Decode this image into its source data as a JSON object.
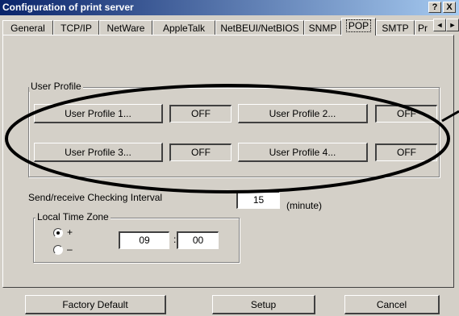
{
  "window": {
    "title": "Configuration of print server",
    "help_label": "?",
    "close_label": "X"
  },
  "tabs": [
    "General",
    "TCP/IP",
    "NetWare",
    "AppleTalk",
    "NetBEUI/NetBIOS",
    "SNMP",
    "POP",
    "SMTP",
    "Pr"
  ],
  "active_tab": "POP",
  "user_profile": {
    "group_label": "User Profile",
    "profiles": [
      {
        "label": "User Profile 1...",
        "status": "OFF"
      },
      {
        "label": "User Profile 2...",
        "status": "OFF"
      },
      {
        "label": "User Profile 3...",
        "status": "OFF"
      },
      {
        "label": "User Profile 4...",
        "status": "OFF"
      }
    ]
  },
  "interval": {
    "label": "Send/receive Checking Interval",
    "value": "15",
    "unit": "(minute)"
  },
  "timezone": {
    "group_label": "Local Time Zone",
    "plus_label": "+",
    "minus_label": "–",
    "selected": "+",
    "hours": "09",
    "separator": ":",
    "minutes": "00"
  },
  "buttons": {
    "factory_default": "Factory Default",
    "setup": "Setup",
    "cancel": "Cancel"
  },
  "icons": {
    "tab_scroll_left": "◄",
    "tab_scroll_right": "►"
  }
}
